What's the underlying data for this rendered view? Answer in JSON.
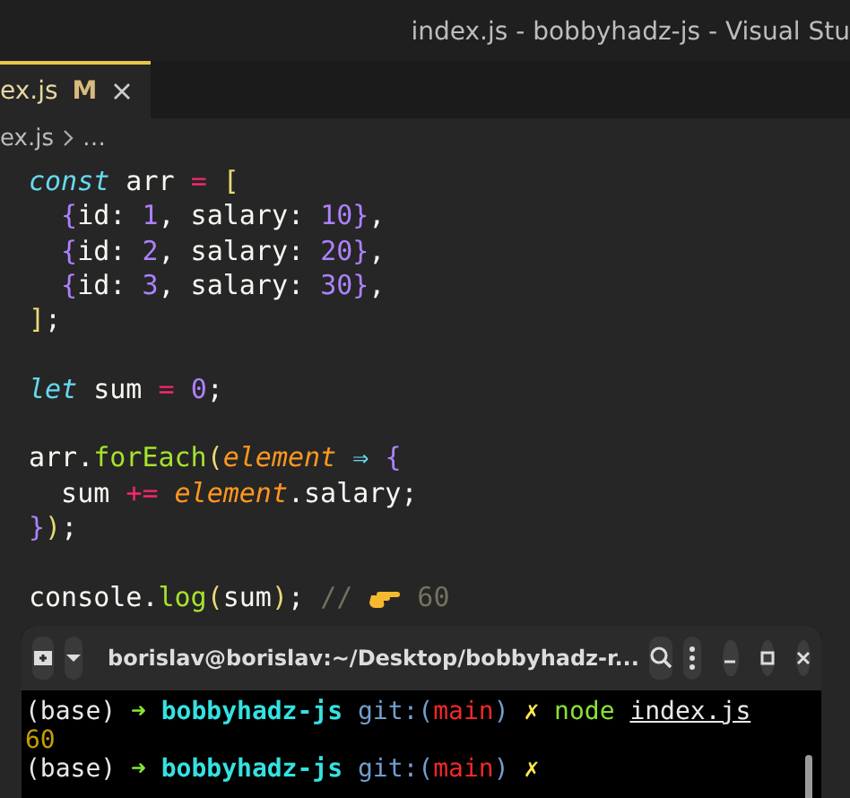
{
  "window": {
    "title": "index.js - bobbyhadz-js - Visual Stu"
  },
  "tabs": [
    {
      "label": "ex.js",
      "badge": "M",
      "selected": true
    }
  ],
  "breadcrumb": {
    "file": "ex.js",
    "more": "…"
  },
  "editor": {
    "lines": [
      {
        "kind": "code",
        "tokens": [
          {
            "t": "const",
            "kind": "keyword"
          },
          {
            "t": " arr ",
            "kind": "plain"
          },
          {
            "t": "= ",
            "kind": "operator"
          },
          {
            "t": "[",
            "kind": "bracket"
          }
        ]
      },
      {
        "kind": "code",
        "tokens": [
          {
            "t": "  {",
            "kind": "brace"
          },
          {
            "t": "id: ",
            "kind": "plain"
          },
          {
            "t": "1",
            "kind": "number"
          },
          {
            "t": ", salary: ",
            "kind": "plain"
          },
          {
            "t": "10",
            "kind": "number"
          },
          {
            "t": "}",
            "kind": "brace"
          },
          {
            "t": ",",
            "kind": "plain"
          }
        ]
      },
      {
        "kind": "code",
        "tokens": [
          {
            "t": "  {",
            "kind": "brace"
          },
          {
            "t": "id: ",
            "kind": "plain"
          },
          {
            "t": "2",
            "kind": "number"
          },
          {
            "t": ", salary: ",
            "kind": "plain"
          },
          {
            "t": "20",
            "kind": "number"
          },
          {
            "t": "}",
            "kind": "brace"
          },
          {
            "t": ",",
            "kind": "plain"
          }
        ]
      },
      {
        "kind": "code",
        "tokens": [
          {
            "t": "  {",
            "kind": "brace"
          },
          {
            "t": "id: ",
            "kind": "plain"
          },
          {
            "t": "3",
            "kind": "number"
          },
          {
            "t": ", salary: ",
            "kind": "plain"
          },
          {
            "t": "30",
            "kind": "number"
          },
          {
            "t": "}",
            "kind": "brace"
          },
          {
            "t": ",",
            "kind": "plain"
          }
        ]
      },
      {
        "kind": "code",
        "tokens": [
          {
            "t": "]",
            "kind": "bracket"
          },
          {
            "t": ";",
            "kind": "plain"
          }
        ]
      },
      {
        "kind": "blank"
      },
      {
        "kind": "code",
        "tokens": [
          {
            "t": "let",
            "kind": "keyword"
          },
          {
            "t": " sum ",
            "kind": "plain"
          },
          {
            "t": "= ",
            "kind": "operator"
          },
          {
            "t": "0",
            "kind": "number"
          },
          {
            "t": ";",
            "kind": "plain"
          }
        ]
      },
      {
        "kind": "blank"
      },
      {
        "kind": "code",
        "tokens": [
          {
            "t": "arr.",
            "kind": "plain"
          },
          {
            "t": "forEach",
            "kind": "function"
          },
          {
            "t": "(",
            "kind": "bracket"
          },
          {
            "t": "element",
            "kind": "param"
          },
          {
            "t": " ⇒ ",
            "kind": "arrow"
          },
          {
            "t": "{",
            "kind": "brace"
          }
        ]
      },
      {
        "kind": "code",
        "tokens": [
          {
            "t": "  sum ",
            "kind": "plain"
          },
          {
            "t": "+= ",
            "kind": "operator"
          },
          {
            "t": "element",
            "kind": "param"
          },
          {
            "t": ".salary;",
            "kind": "plain"
          }
        ]
      },
      {
        "kind": "code",
        "tokens": [
          {
            "t": "}",
            "kind": "brace"
          },
          {
            "t": ")",
            "kind": "bracket"
          },
          {
            "t": ";",
            "kind": "plain"
          }
        ]
      },
      {
        "kind": "blank"
      },
      {
        "kind": "code",
        "tokens": [
          {
            "t": "console.",
            "kind": "plain"
          },
          {
            "t": "log",
            "kind": "function"
          },
          {
            "t": "(",
            "kind": "bracket"
          },
          {
            "t": "sum",
            "kind": "plain"
          },
          {
            "t": ")",
            "kind": "bracket"
          },
          {
            "t": "; ",
            "kind": "plain"
          },
          {
            "t": "// ",
            "kind": "comment"
          },
          {
            "kind": "hand"
          },
          {
            "t": " 60",
            "kind": "comment"
          }
        ]
      }
    ]
  },
  "terminal": {
    "title": "borislav@borislav:~/Desktop/bobbyhadz-r...",
    "lines": [
      {
        "tokens": [
          {
            "t": "(base) ",
            "kind": "plain"
          },
          {
            "t": "➜ ",
            "kind": "arrow"
          },
          {
            "t": "bobbyhadz-js",
            "kind": "dir"
          },
          {
            "t": " git:(",
            "kind": "git"
          },
          {
            "t": "main",
            "kind": "branch"
          },
          {
            "t": ")",
            "kind": "git"
          },
          {
            "t": " ✗",
            "kind": "dirty"
          },
          {
            "t": " node ",
            "kind": "command"
          },
          {
            "t": "index.js",
            "kind": "path"
          }
        ]
      },
      {
        "tokens": [
          {
            "t": "60",
            "kind": "output"
          }
        ]
      },
      {
        "tokens": [
          {
            "t": "(base) ",
            "kind": "plain"
          },
          {
            "t": "➜ ",
            "kind": "arrow"
          },
          {
            "t": "bobbyhadz-js",
            "kind": "dir"
          },
          {
            "t": " git:(",
            "kind": "git"
          },
          {
            "t": "main",
            "kind": "branch"
          },
          {
            "t": ")",
            "kind": "git"
          },
          {
            "t": " ✗",
            "kind": "dirty"
          }
        ]
      }
    ]
  }
}
